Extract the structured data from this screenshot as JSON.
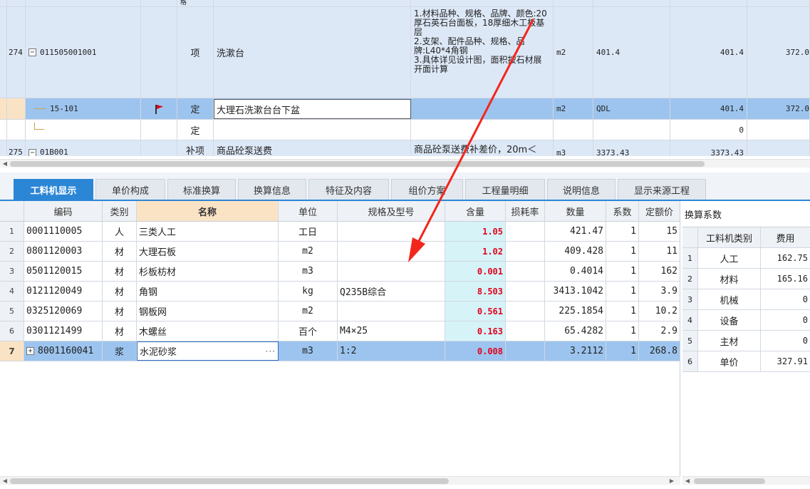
{
  "top_grid": {
    "partial_row_text": "格",
    "item_row": {
      "no": "274",
      "code": "011505001001",
      "type": "项",
      "name": "洗漱台",
      "desc": "1.材料品种、规格、品牌、颜色:20厚石英石台面板，18厚细木工板基层\n2.支架、配件品种、规格、品牌:L40*4角钢\n3.具体详见设计图，面积按石材展开面计算",
      "unit": "m2",
      "expr": "401.4",
      "qty": "401.4",
      "price": "372.0"
    },
    "quota_row": {
      "code": "15-101",
      "type": "定",
      "name": "大理石洗漱台台下盆",
      "unit": "m2",
      "expr": "QDL",
      "qty": "401.4",
      "price": "372.0"
    },
    "empty_row": {
      "type": "定",
      "qty": "0"
    },
    "next_row": {
      "no": "275",
      "code": "01B001",
      "type": "补项",
      "name": "商品砼泵送费",
      "desc": "商品砼泵送费补差价，20m＜",
      "unit": "m3",
      "expr": "3373.43",
      "qty": "3373.43"
    }
  },
  "tabs": [
    "工料机显示",
    "单价构成",
    "标准换算",
    "换算信息",
    "特征及内容",
    "组价方案",
    "工程量明细",
    "说明信息",
    "显示来源工程"
  ],
  "bottom_grid": {
    "headers": [
      "编码",
      "类别",
      "名称",
      "单位",
      "规格及型号",
      "含量",
      "损耗率",
      "数量",
      "系数",
      "定额价"
    ],
    "rows": [
      {
        "no": "1",
        "code": "0001110005",
        "cat": "人",
        "name": "三类人工",
        "unit": "工日",
        "spec": "",
        "content": "1.05",
        "loss": "",
        "qty": "421.47",
        "coef": "1",
        "price": "15"
      },
      {
        "no": "2",
        "code": "0801120003",
        "cat": "材",
        "name": "大理石板",
        "unit": "m2",
        "spec": "",
        "content": "1.02",
        "loss": "",
        "qty": "409.428",
        "coef": "1",
        "price": "11"
      },
      {
        "no": "3",
        "code": "0501120015",
        "cat": "材",
        "name": "杉板枋材",
        "unit": "m3",
        "spec": "",
        "content": "0.001",
        "loss": "",
        "qty": "0.4014",
        "coef": "1",
        "price": "162"
      },
      {
        "no": "4",
        "code": "0121120049",
        "cat": "材",
        "name": "角钢",
        "unit": "kg",
        "spec": "Q235B综合",
        "content": "8.503",
        "loss": "",
        "qty": "3413.1042",
        "coef": "1",
        "price": "3.9"
      },
      {
        "no": "5",
        "code": "0325120069",
        "cat": "材",
        "name": "钢板网",
        "unit": "m2",
        "spec": "",
        "content": "0.561",
        "loss": "",
        "qty": "225.1854",
        "coef": "1",
        "price": "10.2"
      },
      {
        "no": "6",
        "code": "0301121499",
        "cat": "材",
        "name": "木螺丝",
        "unit": "百个",
        "spec": "M4×25",
        "content": "0.163",
        "loss": "",
        "qty": "65.4282",
        "coef": "1",
        "price": "2.9"
      },
      {
        "no": "7",
        "code": "8001160041",
        "cat": "浆",
        "name": "水泥砂浆",
        "unit": "m3",
        "spec": "1:2",
        "content": "0.008",
        "loss": "",
        "qty": "3.2112",
        "coef": "1",
        "price": "268.8"
      }
    ]
  },
  "right_panel": {
    "title": "换算系数",
    "headers": [
      "工料机类别",
      "费用"
    ],
    "rows": [
      {
        "no": "1",
        "cat": "人工",
        "fee": "162.75"
      },
      {
        "no": "2",
        "cat": "材料",
        "fee": "165.16"
      },
      {
        "no": "3",
        "cat": "机械",
        "fee": "0"
      },
      {
        "no": "4",
        "cat": "设备",
        "fee": "0"
      },
      {
        "no": "5",
        "cat": "主材",
        "fee": "0"
      },
      {
        "no": "6",
        "cat": "单价",
        "fee": "327.91"
      }
    ]
  },
  "colors": {
    "accent": "#2c86d6",
    "selected_row": "#9cc4ee",
    "item_row": "#dde8f7",
    "qty_red": "#e3001b",
    "annotation_arrow": "#f2271c",
    "flag": "#e3001b"
  }
}
